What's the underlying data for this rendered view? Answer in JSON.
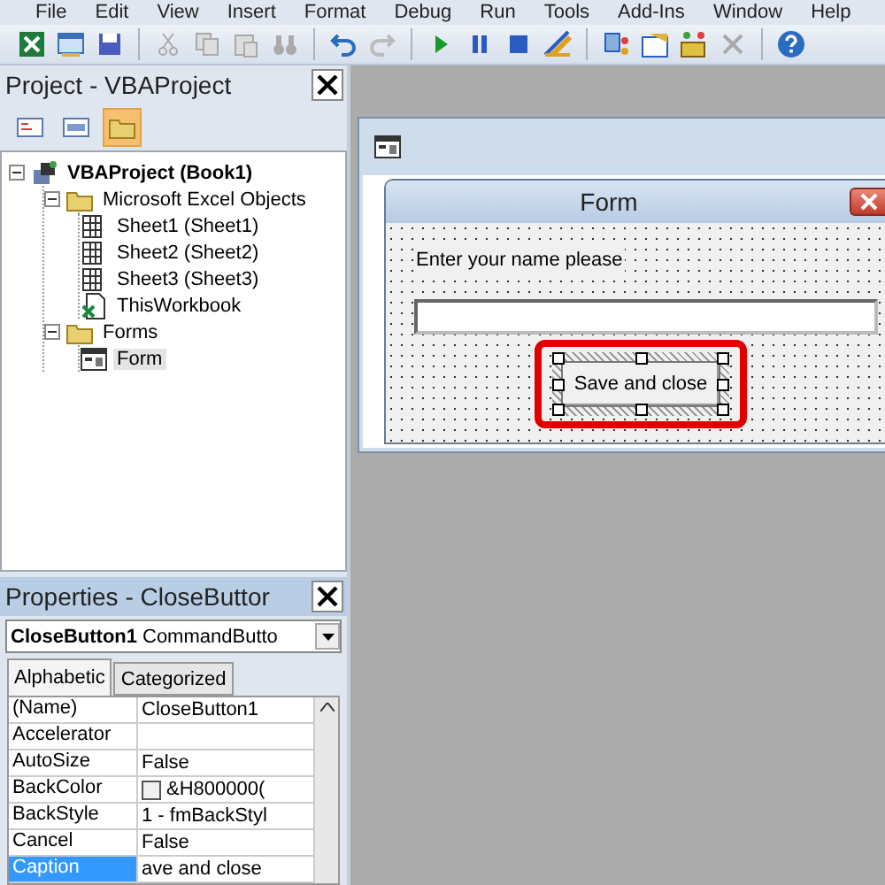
{
  "menu": [
    "File",
    "Edit",
    "View",
    "Insert",
    "Format",
    "Debug",
    "Run",
    "Tools",
    "Add-Ins",
    "Window",
    "Help"
  ],
  "project": {
    "title": "Project - VBAProject",
    "view_buttons": [
      {
        "kind": "code",
        "selected": false
      },
      {
        "kind": "object",
        "selected": false
      },
      {
        "kind": "folders",
        "selected": true
      }
    ],
    "tree": [
      {
        "label": "VBAProject (Book1)",
        "kind": "project",
        "expanded": true,
        "selected": false,
        "children": [
          {
            "label": "Microsoft Excel Objects",
            "kind": "folder",
            "expanded": true,
            "selected": false,
            "children": [
              {
                "label": "Sheet1 (Sheet1)",
                "kind": "sheet",
                "selected": false
              },
              {
                "label": "Sheet2 (Sheet2)",
                "kind": "sheet",
                "selected": false
              },
              {
                "label": "Sheet3 (Sheet3)",
                "kind": "sheet",
                "selected": false
              },
              {
                "label": "ThisWorkbook",
                "kind": "workbook",
                "selected": false
              }
            ]
          },
          {
            "label": "Forms",
            "kind": "folder",
            "expanded": true,
            "selected": false,
            "children": [
              {
                "label": "Form",
                "kind": "form",
                "selected": true
              }
            ]
          }
        ]
      }
    ]
  },
  "properties": {
    "title": "Properties - CloseButtor",
    "object_name": "CloseButton1",
    "object_type": "CommandButto",
    "tabs": [
      {
        "label": "Alphabetic",
        "selected": true
      },
      {
        "label": "Categorized",
        "selected": false
      }
    ],
    "rows": [
      {
        "name": "(Name)",
        "value": "CloseButton1",
        "kind": "text",
        "selected": false
      },
      {
        "name": "Accelerator",
        "kind": "text",
        "selected": false
      },
      {
        "name": "AutoSize",
        "value": "False",
        "kind": "text",
        "selected": false
      },
      {
        "name": "BackColor",
        "value": "&H800000(",
        "kind": "color",
        "selected": false
      },
      {
        "name": "BackStyle",
        "value": "1 - fmBackStyl",
        "kind": "text",
        "selected": false
      },
      {
        "name": "Cancel",
        "value": "False",
        "kind": "text",
        "selected": false
      },
      {
        "name": "Caption",
        "value": "ave and close",
        "kind": "text",
        "selected": true
      }
    ]
  },
  "form": {
    "title": "Form",
    "label": "Enter your name please",
    "button": {
      "label": "Save and close",
      "selected": true,
      "highlighted": true
    }
  }
}
